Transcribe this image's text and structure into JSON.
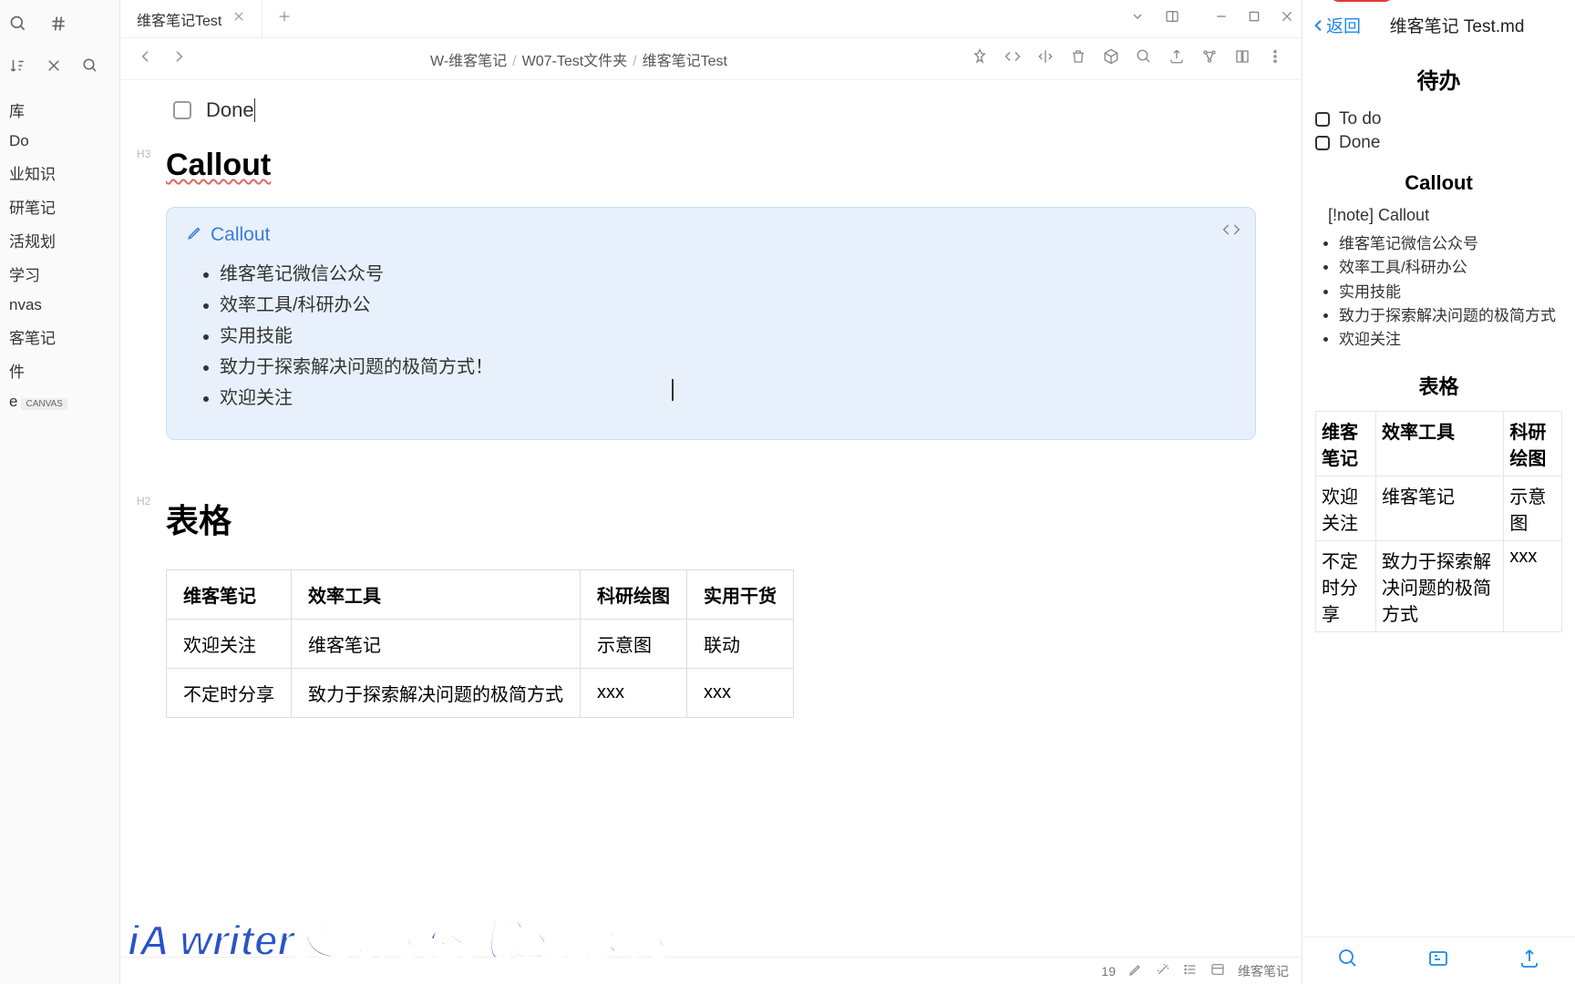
{
  "sidebar": {
    "items": [
      "库",
      "Do",
      "业知识",
      "研笔记",
      "活规划",
      "学习",
      "nvas",
      "客笔记",
      "件",
      "e"
    ],
    "canvas_badge": "CANVAS"
  },
  "tab": {
    "title": "维客笔记Test"
  },
  "breadcrumb": {
    "a": "W-维客笔记",
    "b": "W07-Test文件夹",
    "c": "维客笔记Test"
  },
  "editor": {
    "task_done": "Done",
    "h3": "Callout",
    "callout_title": "Callout",
    "callout_items": [
      "维客笔记微信公众号",
      "效率工具/科研办公",
      "实用技能",
      "致力于探索解决问题的极简方式！",
      "欢迎关注"
    ],
    "h2": "表格",
    "table": {
      "headers": [
        "维客笔记",
        "效率工具",
        "科研绘图",
        "实用干货"
      ],
      "rows": [
        [
          "欢迎关注",
          "维客笔记",
          "示意图",
          "联动"
        ],
        [
          "不定时分享",
          "致力于探索解决问题的极简方式",
          "xxx",
          "xxx"
        ]
      ]
    }
  },
  "status": {
    "count": "19",
    "vault": "维客笔记"
  },
  "phone": {
    "back": "返回",
    "title": "维客笔记 Test.md",
    "h_todo": "待办",
    "todo1": "To do",
    "todo2": "Done",
    "h_callout": "Callout",
    "note_raw": "[!note] Callout",
    "list": [
      "维客笔记微信公众号",
      "效率工具/科研办公",
      "实用技能",
      "致力于探索解决问题的极简方式",
      "欢迎关注"
    ],
    "h_table": "表格",
    "table": {
      "headers": [
        "维客笔记",
        "效率工具",
        "科研绘图"
      ],
      "rows": [
        [
          "欢迎关注",
          "维客笔记",
          "示意图"
        ],
        [
          "不定时分享",
          "致力于探索解决问题的极简方式",
          "xxx"
        ]
      ]
    }
  },
  "subtitle": "iA writer支持的格式还挺多的"
}
